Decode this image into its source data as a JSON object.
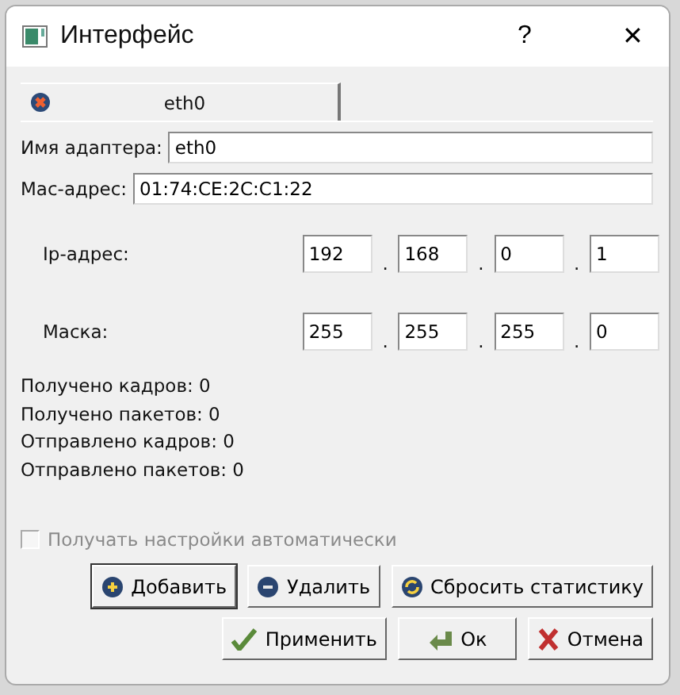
{
  "window": {
    "title": "Интерфейс",
    "help": "?",
    "close": "✕"
  },
  "tabs": [
    {
      "label": "eth0",
      "selected": true
    }
  ],
  "fields": [
    {
      "label": "Имя адаптера:",
      "value": "eth0"
    },
    {
      "label": "Mac-адрес:",
      "value": "01:74:CE:2C:C1:22"
    }
  ],
  "ip_rows": [
    {
      "label": "Ip-адрес:",
      "octets": [
        "192",
        "168",
        "0",
        "1"
      ]
    },
    {
      "label": "Маска:",
      "octets": [
        "255",
        "255",
        "255",
        "0"
      ]
    }
  ],
  "separator": ".",
  "stats": [
    "Получено кадров: 0",
    "Получено пакетов: 0",
    "Отправлено кадров: 0",
    "Отправлено пакетов: 0"
  ],
  "auto_checkbox": {
    "label": "Получать настройки автоматически",
    "checked": false,
    "disabled": true
  },
  "action_buttons": [
    {
      "label": "Добавить",
      "kind": "add",
      "default": true
    },
    {
      "label": "Удалить",
      "kind": "remove",
      "default": false
    },
    {
      "label": "Сбросить статистику",
      "kind": "reset",
      "default": false
    }
  ],
  "dialog_buttons": [
    {
      "label": "Применить",
      "kind": "apply"
    },
    {
      "label": "Ок",
      "kind": "ok"
    },
    {
      "label": "Отмена",
      "kind": "cancel"
    }
  ]
}
